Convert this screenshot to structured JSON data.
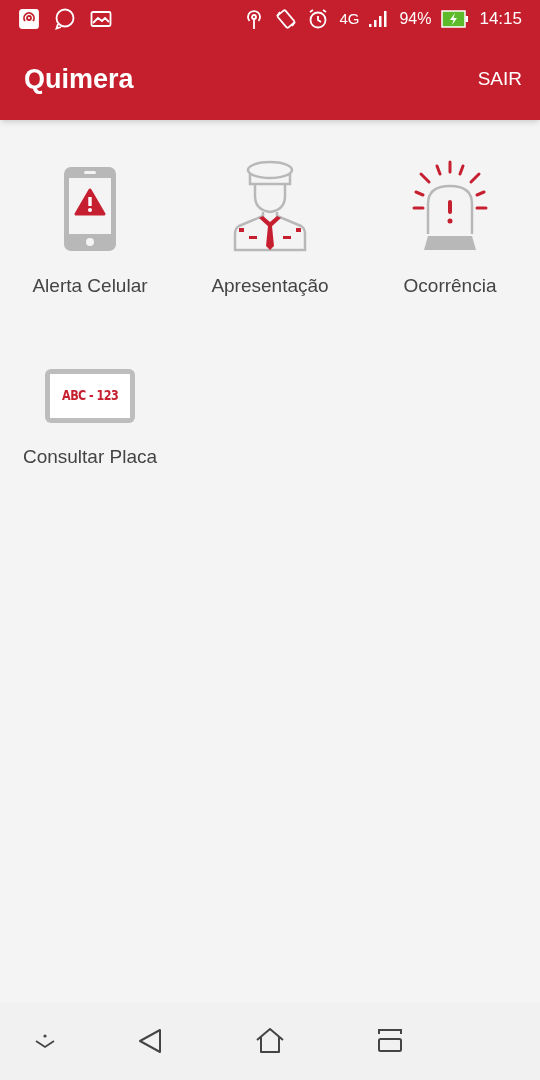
{
  "status_bar": {
    "network": "4G",
    "battery": "94%",
    "time": "14:15"
  },
  "app_bar": {
    "title": "Quimera",
    "action": "SAIR"
  },
  "menu": [
    {
      "kind": "phone-alert",
      "label": "Alerta Celular"
    },
    {
      "kind": "officer",
      "label": "Apresentação"
    },
    {
      "kind": "siren",
      "label": "Ocorrência"
    },
    {
      "kind": "plate",
      "label": "Consultar Placa",
      "plate_text": "ABC - 123"
    }
  ]
}
